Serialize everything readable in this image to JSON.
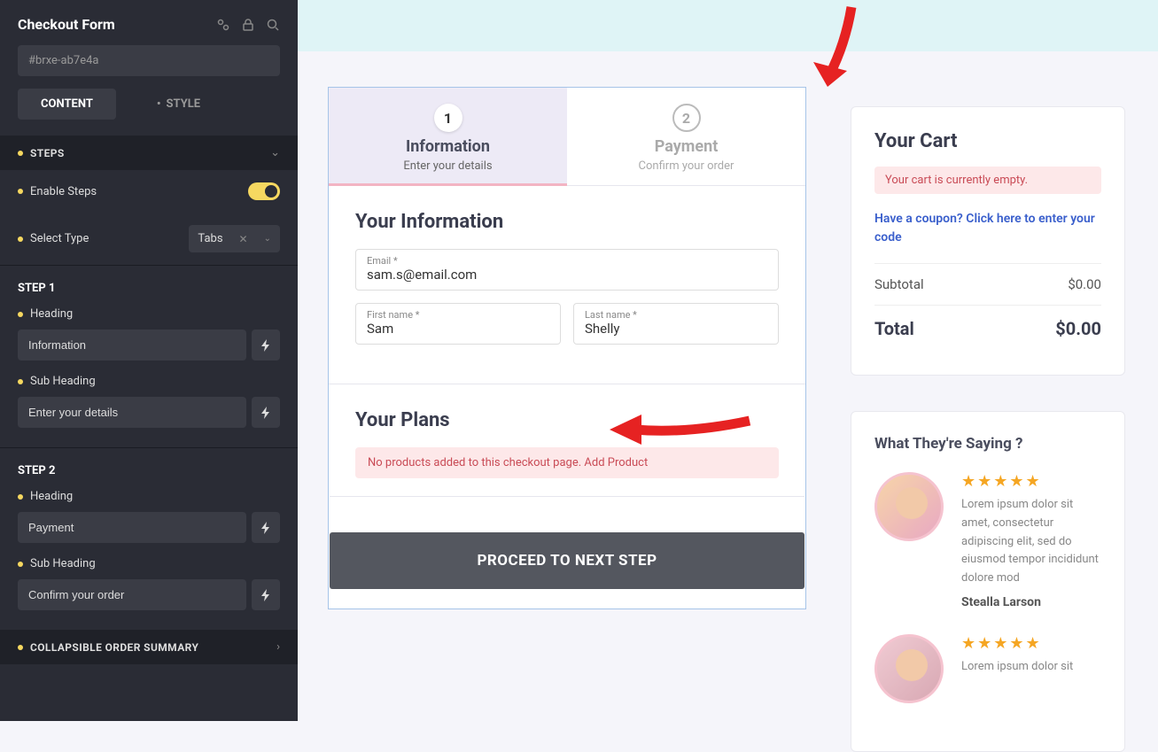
{
  "sidebar": {
    "title": "Checkout Form",
    "element_id": "#brxe-ab7e4a",
    "tab_content": "CONTENT",
    "tab_style": "STYLE",
    "sections": {
      "steps": {
        "label": "STEPS",
        "enable_steps_label": "Enable Steps",
        "select_type_label": "Select Type",
        "select_type_value": "Tabs"
      },
      "step1": {
        "title": "STEP 1",
        "heading_label": "Heading",
        "heading_value": "Information",
        "subheading_label": "Sub Heading",
        "subheading_value": "Enter your details"
      },
      "step2": {
        "title": "STEP 2",
        "heading_label": "Heading",
        "heading_value": "Payment",
        "subheading_label": "Sub Heading",
        "subheading_value": "Confirm your order"
      },
      "collapsible": {
        "label": "COLLAPSIBLE ORDER SUMMARY"
      }
    }
  },
  "checkout": {
    "tabs": [
      {
        "num": "1",
        "title": "Information",
        "sub": "Enter your details"
      },
      {
        "num": "2",
        "title": "Payment",
        "sub": "Confirm your order"
      }
    ],
    "info": {
      "heading": "Your Information",
      "email_label": "Email *",
      "email_value": "sam.s@email.com",
      "first_label": "First name *",
      "first_value": "Sam",
      "last_label": "Last name *",
      "last_value": "Shelly"
    },
    "plans": {
      "heading": "Your Plans",
      "alert_text": "No products added to this checkout page. ",
      "alert_link": "Add Product"
    },
    "button": "PROCEED TO NEXT STEP"
  },
  "cart": {
    "title": "Your Cart",
    "empty": "Your cart is currently empty.",
    "coupon": "Have a coupon? Click here to enter your code",
    "subtotal_label": "Subtotal",
    "subtotal_value": "$0.00",
    "total_label": "Total",
    "total_value": "$0.00"
  },
  "testimonials": {
    "title": "What They're Saying ?",
    "items": [
      {
        "text": "Lorem ipsum dolor sit amet, consectetur adipiscing elit, sed do eiusmod tempor incididunt dolore mod",
        "name": "Stealla Larson"
      },
      {
        "text": "Lorem ipsum dolor sit",
        "name": ""
      }
    ]
  }
}
